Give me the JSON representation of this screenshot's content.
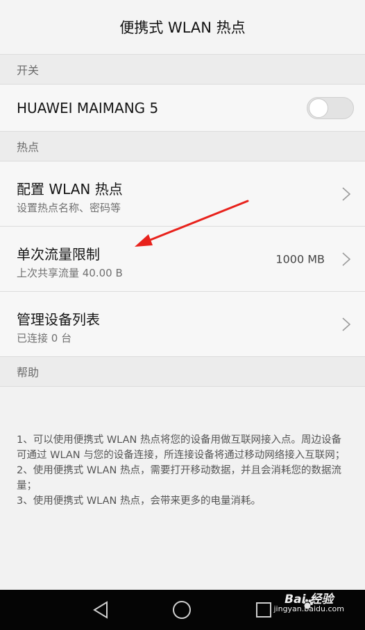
{
  "header": {
    "title": "便携式 WLAN 热点"
  },
  "sections": {
    "switch": {
      "label": "开关"
    },
    "hotspot": {
      "label": "热点"
    },
    "help": {
      "label": "帮助"
    }
  },
  "switch_row": {
    "name": "HUAWEI MAIMANG 5",
    "enabled": false
  },
  "rows": [
    {
      "title": "配置 WLAN 热点",
      "subtitle": "设置热点名称、密码等",
      "value": ""
    },
    {
      "title": "单次流量限制",
      "subtitle": "上次共享流量 40.00 B",
      "value": "1000 MB"
    },
    {
      "title": "管理设备列表",
      "subtitle": "已连接 0 台",
      "value": ""
    }
  ],
  "help_text": "1、可以使用便携式 WLAN 热点将您的设备用做互联网接入点。周边设备可通过 WLAN 与您的设备连接，所连接设备将通过移动网络接入互联网；\n2、使用便携式 WLAN 热点，需要打开移动数据，并且会消耗您的数据流量；\n3、使用便携式 WLAN 热点，会带来更多的电量消耗。",
  "watermark": {
    "brand": "Bai  经验",
    "url": "jingyan.baidu.com"
  },
  "colors": {
    "annotation_arrow": "#e8221c",
    "navbar": "#050505"
  }
}
